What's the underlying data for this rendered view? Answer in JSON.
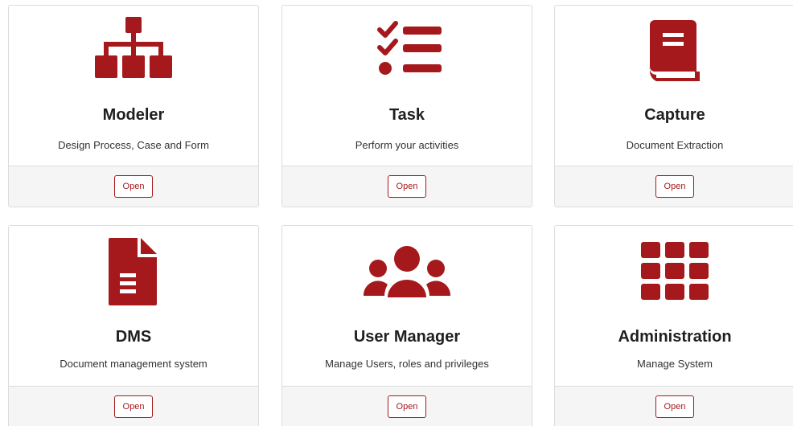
{
  "accent_color": "#a5191c",
  "cards": [
    {
      "title": "Modeler",
      "description": "Design Process, Case and Form",
      "button": "Open",
      "icon": "sitemap-icon"
    },
    {
      "title": "Task",
      "description": "Perform your activities",
      "button": "Open",
      "icon": "tasks-icon"
    },
    {
      "title": "Capture",
      "description": "Document Extraction",
      "button": "Open",
      "icon": "book-icon"
    },
    {
      "title": "DMS",
      "description": "Document management system",
      "button": "Open",
      "icon": "file-icon"
    },
    {
      "title": "User Manager",
      "description": "Manage Users, roles and privileges",
      "button": "Open",
      "icon": "users-icon"
    },
    {
      "title": "Administration",
      "description": "Manage System",
      "button": "Open",
      "icon": "grid-icon"
    }
  ]
}
